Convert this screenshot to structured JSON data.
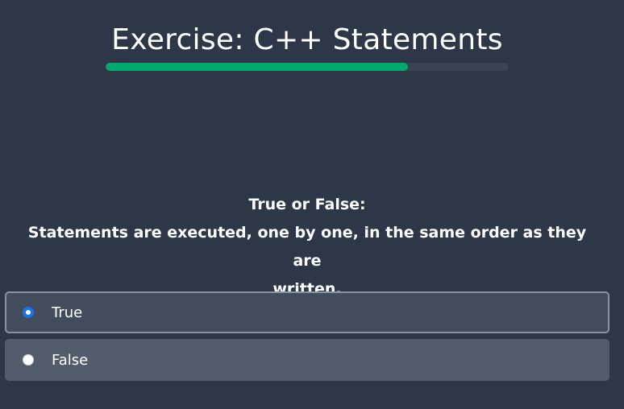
{
  "exercise": {
    "title": "Exercise: C++ Statements",
    "progress": 0.75
  },
  "question": {
    "line1": "True or False:",
    "line2": "Statements are executed, one by one, in the same order as they are",
    "line3": "written."
  },
  "options": [
    {
      "label": "True",
      "selected": true
    },
    {
      "label": "False",
      "selected": false
    }
  ],
  "colors": {
    "background": "#2d3748",
    "progress_fill": "#04aa6d",
    "progress_track": "#3a4353",
    "radio_checked": "#1a73e8"
  }
}
